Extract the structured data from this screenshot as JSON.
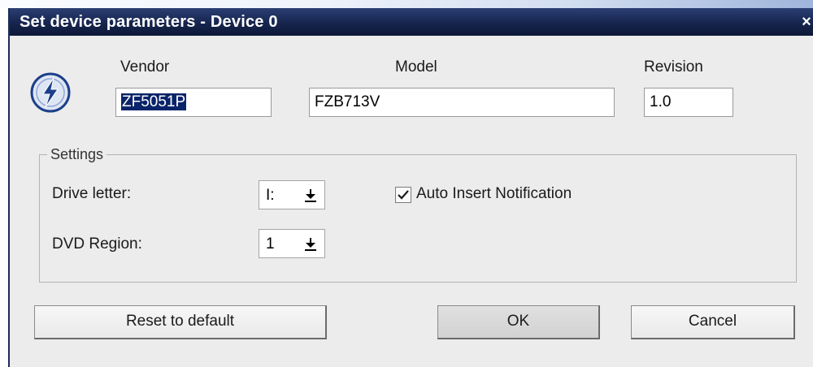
{
  "window": {
    "title": "Set device parameters - Device 0",
    "close_glyph": "×"
  },
  "header": {
    "vendor_label": "Vendor",
    "model_label": "Model",
    "revision_label": "Revision",
    "vendor_value": "ZF5051P",
    "model_value": "FZB713V",
    "revision_value": "1.0",
    "logo_icon": "lightning-disc-icon"
  },
  "settings": {
    "group_label": "Settings",
    "drive_letter_label": "Drive letter:",
    "drive_letter_value": "I:",
    "dvd_region_label": "DVD Region:",
    "dvd_region_value": "1",
    "auto_insert_label": "Auto Insert Notification",
    "auto_insert_checked": true
  },
  "buttons": {
    "reset_label": "Reset to default",
    "ok_label": "OK",
    "cancel_label": "Cancel"
  },
  "colors": {
    "titlebar": "#16254d",
    "selection": "#0a246a",
    "dialog_bg": "#ececec"
  }
}
